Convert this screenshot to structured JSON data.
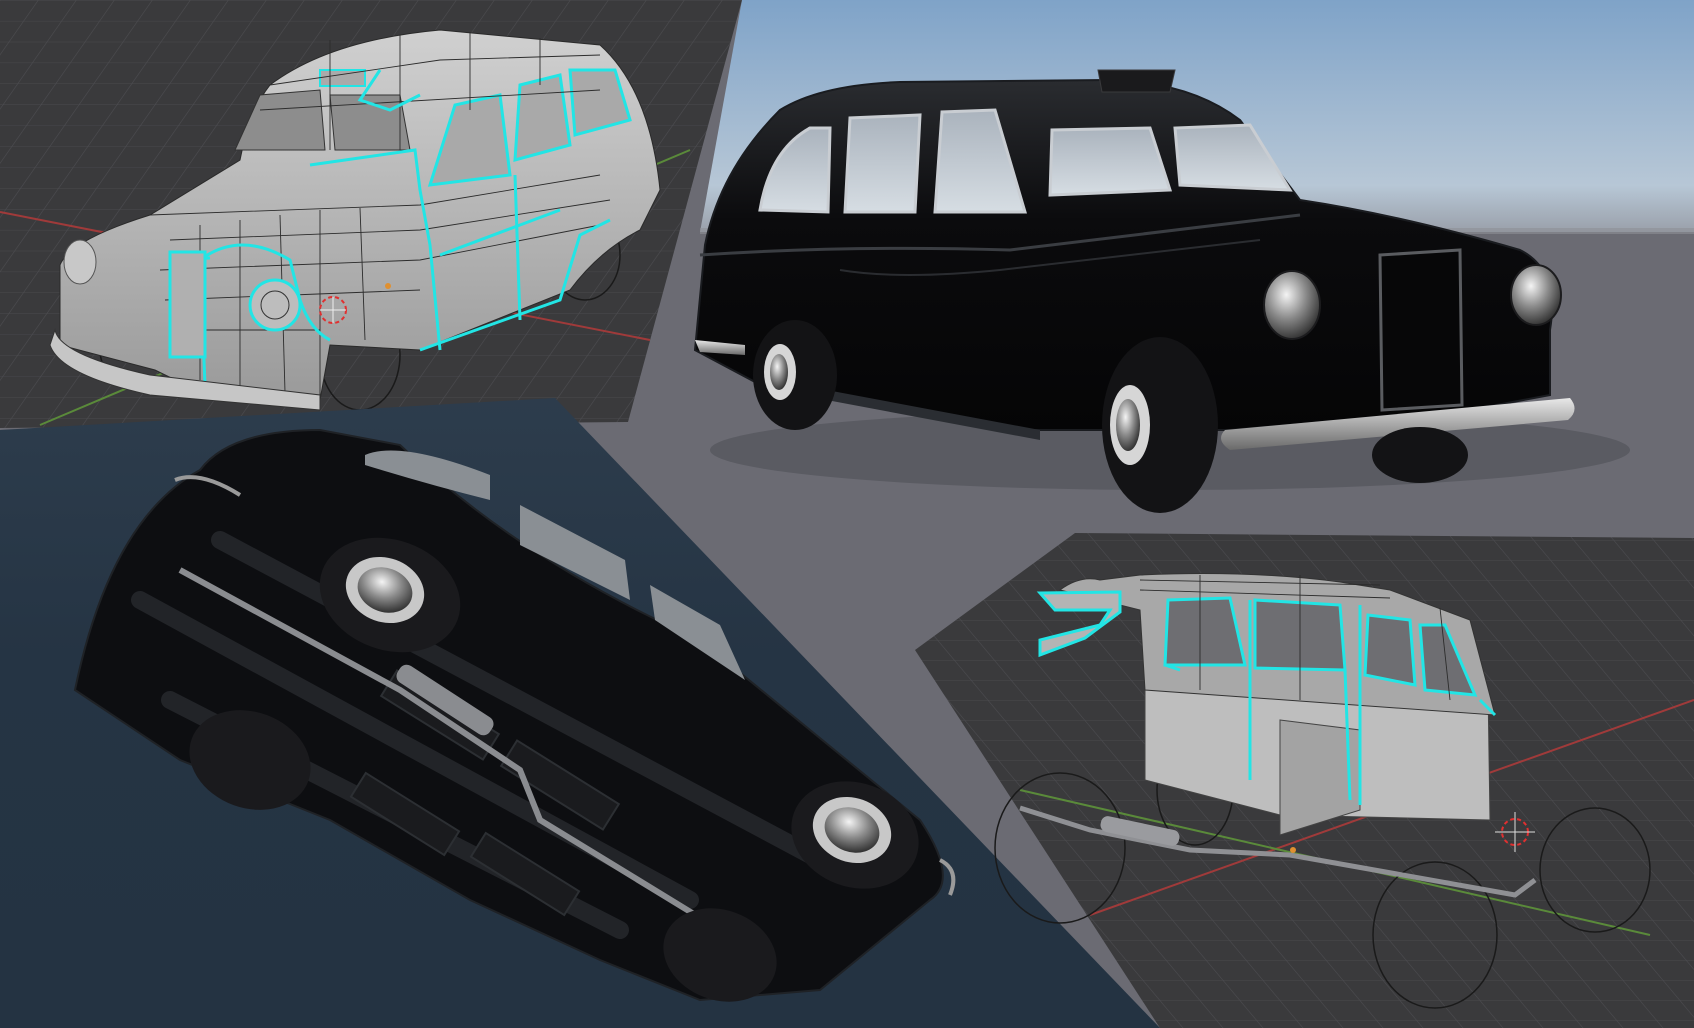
{
  "panels": [
    {
      "id": "wireframe-front",
      "label": ""
    },
    {
      "id": "rendered-front",
      "label": ""
    },
    {
      "id": "rendered-underside",
      "label": ""
    },
    {
      "id": "wireframe-cabin",
      "label": ""
    }
  ],
  "colors": {
    "viewport_bg": "#3c3c3e",
    "grid_line": "#4a4a4d",
    "sky_top": "#7fa3c8",
    "sky_bottom": "#b7c7d6",
    "ground": "#6b6b73",
    "underside_bg": "#2e4256",
    "car_black": "#0c0c0e",
    "mesh_grey": "#b9b9b9",
    "edge_highlight": "#22e5e5",
    "axis_red": "#a03a3a",
    "axis_green": "#5a8a3a"
  },
  "icons": [
    "3d-cursor-icon",
    "origin-dot-icon"
  ]
}
